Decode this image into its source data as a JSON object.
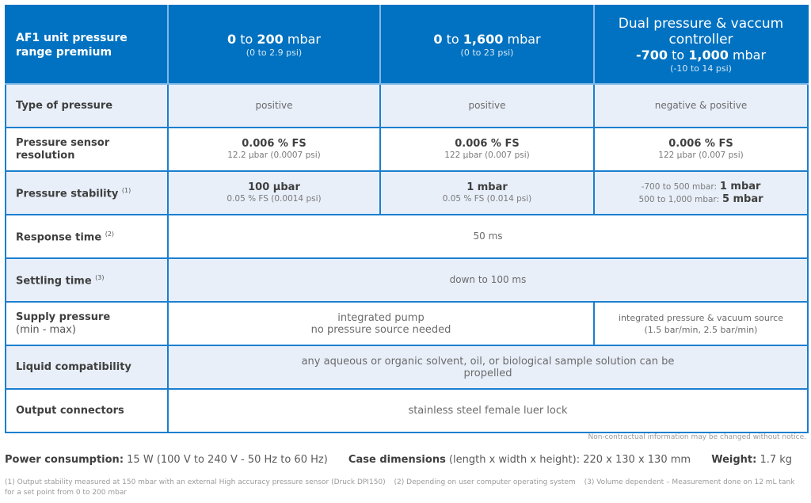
{
  "header": {
    "label": "AF1 unit pressure range premium",
    "columns": [
      {
        "from": "0",
        "to_word": "to",
        "to": "200",
        "unit": "mbar",
        "psi": "(0 to 2.9 psi)"
      },
      {
        "from": "0",
        "to_word": "to",
        "to": "1,600",
        "unit": "mbar",
        "psi": "(0 to 23 psi)"
      },
      {
        "title": "Dual pressure & vaccum controller",
        "from": "-700",
        "to_word": "to",
        "to": "1,000",
        "unit": "mbar",
        "psi": "(-10 to 14 psi)"
      }
    ]
  },
  "rows": {
    "type_of_pressure": {
      "label": "Type of pressure",
      "values": [
        "positive",
        "positive",
        "negative & positive"
      ]
    },
    "resolution": {
      "label": "Pressure sensor resolution",
      "values": [
        {
          "main": "0.006 % FS",
          "minor": "12.2 µbar (0.0007 psi)"
        },
        {
          "main": "0.006 % FS",
          "minor": "122 µbar (0.007 psi)"
        },
        {
          "main": "0.006 % FS",
          "minor": "122 µbar (0.007 psi)"
        }
      ]
    },
    "stability": {
      "label": "Pressure stability",
      "note": "(1)",
      "values": [
        {
          "main": "100 µbar",
          "minor": "0.05 % FS (0.0014 psi)"
        },
        {
          "main": "1 mbar",
          "minor": "0.05 % FS (0.014 psi)"
        },
        {
          "line1_prefix": "-700 to 500 mbar:",
          "line1_value": "1 mbar",
          "line2_prefix": "500 to 1,000 mbar:",
          "line2_value": "5 mbar"
        }
      ]
    },
    "response_time": {
      "label": "Response time",
      "note": "(2)",
      "value": "50 ms"
    },
    "settling_time": {
      "label": "Settling time",
      "note": "(3)",
      "value": "down to 100 ms"
    },
    "supply_pressure": {
      "label": "Supply pressure",
      "sublabel": "(min - max)",
      "value_1_2_line1": "integrated pump",
      "value_1_2_line2": "no pressure source needed",
      "value_3_line1": "integrated pressure & vacuum source",
      "value_3_line2": "(1.5 bar/min, 2.5 bar/min)"
    },
    "liquid_compatibility": {
      "label": "Liquid compatibility",
      "line1": "any aqueous or organic solvent, oil, or biological sample solution can be",
      "line2": "propelled"
    },
    "output_connectors": {
      "label": "Output connectors",
      "value": "stainless steel female luer lock"
    }
  },
  "notice": "Non-contractual information may be changed without notice.",
  "specs": {
    "power_label": "Power consumption:",
    "power_value": "15 W (100 V to 240 V - 50 Hz to 60 Hz)",
    "case_label": "Case dimensions",
    "case_value": "(length x width x height): 220 x 130 x 130 mm",
    "weight_label": "Weight:",
    "weight_value": "1.7 kg"
  },
  "footnotes": [
    "(1) Output stability measured at 150 mbar with an external High accuracy pressure sensor (Druck DPI150)",
    "(2) Depending on user computer operating system",
    "(3) Volume dependent – Measurement done on 12 mL tank for a set point from 0 to 200 mbar"
  ],
  "colors": {
    "header_bg": "#0072c1",
    "border": "#1a7fcf",
    "alt_row_bg": "#e8eff9"
  }
}
